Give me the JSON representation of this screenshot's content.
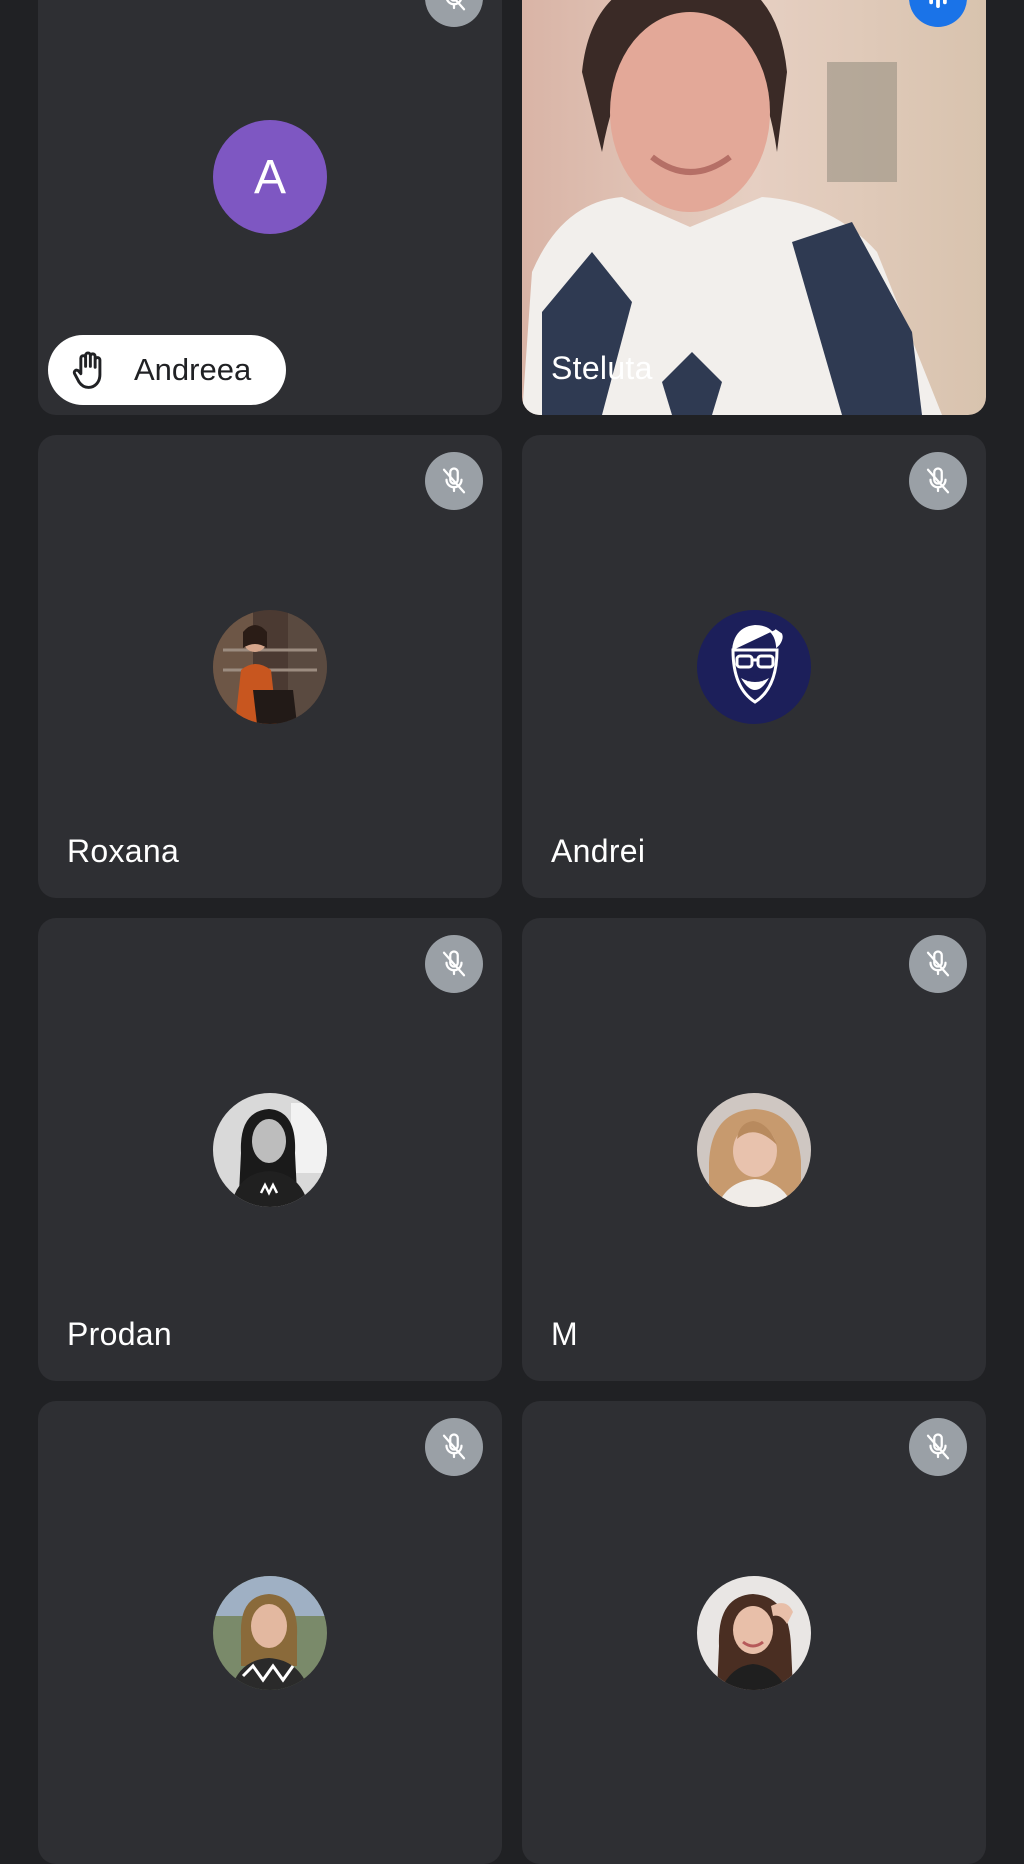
{
  "participants": [
    {
      "name": "Andreea",
      "avatar_letter": "A",
      "hand_raised": true,
      "muted": true,
      "icon": "mic-off-icon"
    },
    {
      "name": "Steluta",
      "video_on": true,
      "speaking": true,
      "icon": "audio-level-icon"
    },
    {
      "name": "Roxana",
      "muted": true,
      "icon": "mic-off-icon"
    },
    {
      "name": "Andrei",
      "muted": true,
      "icon": "mic-off-icon"
    },
    {
      "name": "Prodan",
      "muted": true,
      "icon": "mic-off-icon"
    },
    {
      "name": "M",
      "muted": true,
      "icon": "mic-off-icon"
    },
    {
      "name": "",
      "muted": true,
      "icon": "mic-off-icon"
    },
    {
      "name": "",
      "muted": true,
      "icon": "mic-off-icon"
    }
  ],
  "colors": {
    "background": "#202124",
    "tile": "#2e2f33",
    "avatar_letter_bg": "#7e57c2",
    "mic_badge": "#9aa0a6",
    "speaking_badge": "#1a73e8"
  }
}
